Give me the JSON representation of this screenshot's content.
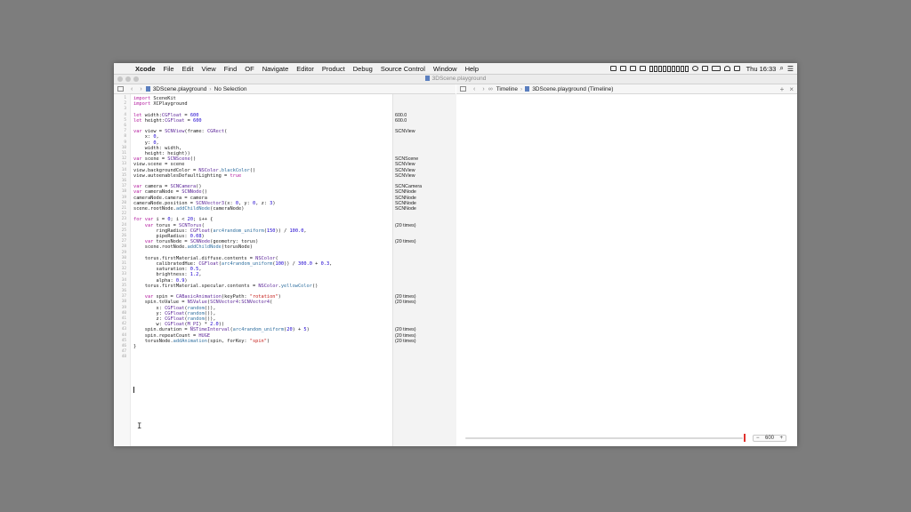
{
  "menubar": {
    "app_name": "Xcode",
    "items": [
      "File",
      "Edit",
      "View",
      "Find",
      "OF",
      "Navigate",
      "Editor",
      "Product",
      "Debug",
      "Source Control",
      "Window",
      "Help"
    ],
    "clock": "Thu 16:33"
  },
  "window": {
    "title": "3DScene.playground"
  },
  "editor_jumpbar": {
    "file": "3DScene.playground",
    "selection": "No Selection"
  },
  "timeline_jumpbar": {
    "mode": "Timeline",
    "file": "3DScene.playground (Timeline)"
  },
  "code_lines": [
    {
      "n": 1,
      "t": "import SceneKit"
    },
    {
      "n": 2,
      "t": "import XCPlayground"
    },
    {
      "n": 3,
      "t": ""
    },
    {
      "n": 4,
      "t": "let width:CGFloat = 600"
    },
    {
      "n": 5,
      "t": "let height:CGFloat = 600"
    },
    {
      "n": 6,
      "t": ""
    },
    {
      "n": 7,
      "t": "var view = SCNView(frame: CGRect("
    },
    {
      "n": 8,
      "t": "    x: 0,"
    },
    {
      "n": 9,
      "t": "    y: 0,"
    },
    {
      "n": 10,
      "t": "    width: width,"
    },
    {
      "n": 11,
      "t": "    height: height))"
    },
    {
      "n": 12,
      "t": "var scene = SCNScene()"
    },
    {
      "n": 13,
      "t": "view.scene = scene"
    },
    {
      "n": 14,
      "t": "view.backgroundColor = NSColor.blackColor()"
    },
    {
      "n": 15,
      "t": "view.autoenablesDefaultLighting = true"
    },
    {
      "n": 16,
      "t": ""
    },
    {
      "n": 17,
      "t": "var camera = SCNCamera()"
    },
    {
      "n": 18,
      "t": "var cameraNode = SCNNode()"
    },
    {
      "n": 19,
      "t": "cameraNode.camera = camera"
    },
    {
      "n": 20,
      "t": "cameraNode.position = SCNVector3(x: 0, y: 0, z: 3)"
    },
    {
      "n": 21,
      "t": "scene.rootNode.addChildNode(cameraNode)"
    },
    {
      "n": 22,
      "t": ""
    },
    {
      "n": 23,
      "t": "for var i = 0; i < 20; i++ {"
    },
    {
      "n": 24,
      "t": "    var torus = SCNTorus("
    },
    {
      "n": 25,
      "t": "        ringRadius: CGFloat(arc4random_uniform(150)) / 100.0,"
    },
    {
      "n": 26,
      "t": "        pipeRadius: 0.08)"
    },
    {
      "n": 27,
      "t": "    var torusNode = SCNNode(geometry: torus)"
    },
    {
      "n": 28,
      "t": "    scene.rootNode.addChildNode(torusNode)"
    },
    {
      "n": 29,
      "t": ""
    },
    {
      "n": 30,
      "t": "    torus.firstMaterial.diffuse.contents = NSColor("
    },
    {
      "n": 31,
      "t": "        calibratedHue: CGFloat(arc4random_uniform(100)) / 300.0 + 0.3,"
    },
    {
      "n": 32,
      "t": "        saturation: 0.5,"
    },
    {
      "n": 33,
      "t": "        brightness: 1.2,"
    },
    {
      "n": 34,
      "t": "        alpha: 0.9)"
    },
    {
      "n": 35,
      "t": "    torus.firstMaterial.specular.contents = NSColor.yellowColor()"
    },
    {
      "n": 36,
      "t": ""
    },
    {
      "n": 37,
      "t": "    var spin = CABasicAnimation(keyPath: \"rotation\")"
    },
    {
      "n": 38,
      "t": "    spin.toValue = NSValue(SCNVector4:SCNVector4("
    },
    {
      "n": 39,
      "t": "        x: CGFloat(random()),"
    },
    {
      "n": 40,
      "t": "        y: CGFloat(random()),"
    },
    {
      "n": 41,
      "t": "        z: CGFloat(random()),"
    },
    {
      "n": 42,
      "t": "        w: CGFloat(M_PI) * 2.0))"
    },
    {
      "n": 43,
      "t": "    spin.duration = NSTimeInterval(arc4random_uniform(20) + 5)"
    },
    {
      "n": 44,
      "t": "    spin.repeatCount = HUGE"
    },
    {
      "n": 45,
      "t": "    torusNode.addAnimation(spin, forKey: \"spin\")"
    },
    {
      "n": 46,
      "t": "}"
    },
    {
      "n": 47,
      "t": ""
    },
    {
      "n": 48,
      "t": ""
    }
  ],
  "results": [
    {
      "line": 4,
      "t": "600.0"
    },
    {
      "line": 5,
      "t": "600.0"
    },
    {
      "line": 7,
      "t": "SCNView"
    },
    {
      "line": 12,
      "t": "SCNScene"
    },
    {
      "line": 13,
      "t": "SCNView"
    },
    {
      "line": 14,
      "t": "SCNView"
    },
    {
      "line": 15,
      "t": "SCNView"
    },
    {
      "line": 17,
      "t": "SCNCamera"
    },
    {
      "line": 18,
      "t": "SCNNode"
    },
    {
      "line": 19,
      "t": "SCNNode"
    },
    {
      "line": 20,
      "t": "SCNNode"
    },
    {
      "line": 21,
      "t": "SCNNode"
    },
    {
      "line": 24,
      "t": "(20 times)"
    },
    {
      "line": 27,
      "t": "(20 times)"
    },
    {
      "line": 37,
      "t": "(20 times)"
    },
    {
      "line": 38,
      "t": "(20 times)"
    },
    {
      "line": 43,
      "t": "(20 times)"
    },
    {
      "line": 44,
      "t": "(20 times)"
    },
    {
      "line": 45,
      "t": "(20 times)"
    }
  ],
  "timeline": {
    "zoom_value": "600"
  }
}
